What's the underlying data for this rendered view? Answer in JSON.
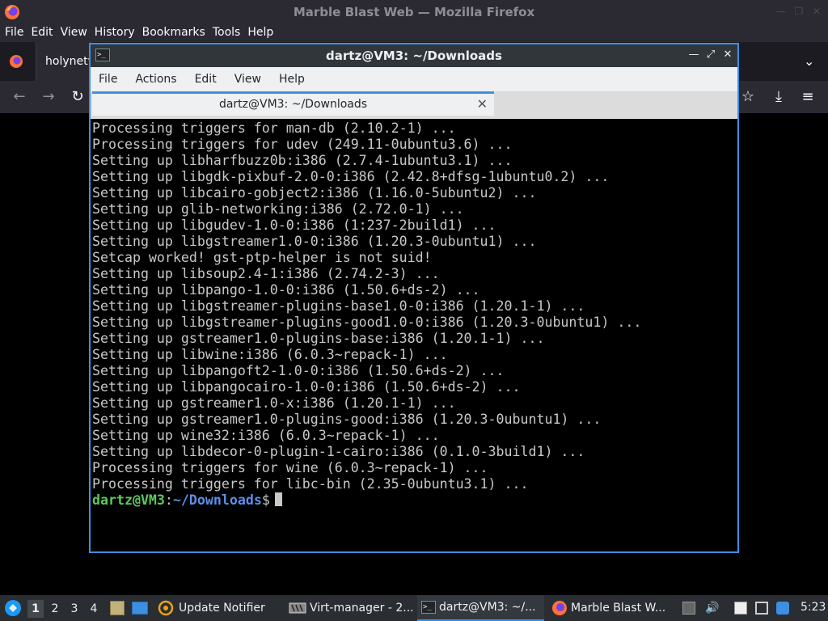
{
  "firefox": {
    "window_title": "Marble Blast Web — Mozilla Firefox",
    "menu": [
      "File",
      "Edit",
      "View",
      "History",
      "Bookmarks",
      "Tools",
      "Help"
    ],
    "tab_label": "holynetw"
  },
  "terminal": {
    "window_title": "dartz@VM3: ~/Downloads",
    "menu": [
      "File",
      "Actions",
      "Edit",
      "View",
      "Help"
    ],
    "tab_label": "dartz@VM3: ~/Downloads",
    "lines": [
      "Processing triggers for man-db (2.10.2-1) ...",
      "Processing triggers for udev (249.11-0ubuntu3.6) ...",
      "Setting up libharfbuzz0b:i386 (2.7.4-1ubuntu3.1) ...",
      "Setting up libgdk-pixbuf-2.0-0:i386 (2.42.8+dfsg-1ubuntu0.2) ...",
      "Setting up libcairo-gobject2:i386 (1.16.0-5ubuntu2) ...",
      "Setting up glib-networking:i386 (2.72.0-1) ...",
      "Setting up libgudev-1.0-0:i386 (1:237-2build1) ...",
      "Setting up libgstreamer1.0-0:i386 (1.20.3-0ubuntu1) ...",
      "Setcap worked! gst-ptp-helper is not suid!",
      "Setting up libsoup2.4-1:i386 (2.74.2-3) ...",
      "Setting up libpango-1.0-0:i386 (1.50.6+ds-2) ...",
      "Setting up libgstreamer-plugins-base1.0-0:i386 (1.20.1-1) ...",
      "Setting up libgstreamer-plugins-good1.0-0:i386 (1.20.3-0ubuntu1) ...",
      "Setting up gstreamer1.0-plugins-base:i386 (1.20.1-1) ...",
      "Setting up libwine:i386 (6.0.3~repack-1) ...",
      "Setting up libpangoft2-1.0-0:i386 (1.50.6+ds-2) ...",
      "Setting up libpangocairo-1.0-0:i386 (1.50.6+ds-2) ...",
      "Setting up gstreamer1.0-x:i386 (1.20.1-1) ...",
      "Setting up gstreamer1.0-plugins-good:i386 (1.20.3-0ubuntu1) ...",
      "Setting up wine32:i386 (6.0.3~repack-1) ...",
      "Setting up libdecor-0-plugin-1-cairo:i386 (0.1.0-3build1) ...",
      "Processing triggers for wine (6.0.3~repack-1) ...",
      "Processing triggers for libc-bin (2.35-0ubuntu3.1) ..."
    ],
    "prompt_user": "dartz@VM3",
    "prompt_sep": ":",
    "prompt_path": "~/Downloads",
    "prompt_end": "$"
  },
  "taskbar": {
    "workspaces": [
      "1",
      "2",
      "3",
      "4"
    ],
    "active_workspace": "1",
    "apps": [
      {
        "label": "Update Notifier",
        "icon": "update-notifier-icon"
      },
      {
        "label": "Virt-manager - 2...",
        "icon": "virt-manager-icon"
      },
      {
        "label": "dartz@VM3: ~/...",
        "icon": "terminal-icon"
      },
      {
        "label": "Marble Blast W...",
        "icon": "firefox-icon"
      }
    ],
    "clock": "5:23"
  },
  "colors": {
    "accent": "#3d8fe2",
    "prompt_user": "#5ec95e",
    "prompt_path": "#5b8fe8",
    "terminal_text": "#c8c8c8"
  }
}
